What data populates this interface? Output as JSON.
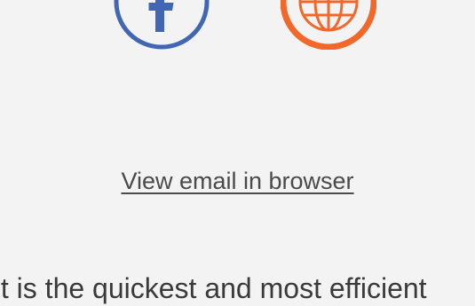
{
  "social": {
    "facebook": {
      "icon": "facebook-icon",
      "color": "#4267b2"
    },
    "website": {
      "icon": "globe-icon",
      "color": "#f2682a"
    }
  },
  "view_in_browser": {
    "label": "View email in browser",
    "color": "#4a4a4a"
  },
  "intro": {
    "text": "It is the quickest and most efficient"
  }
}
